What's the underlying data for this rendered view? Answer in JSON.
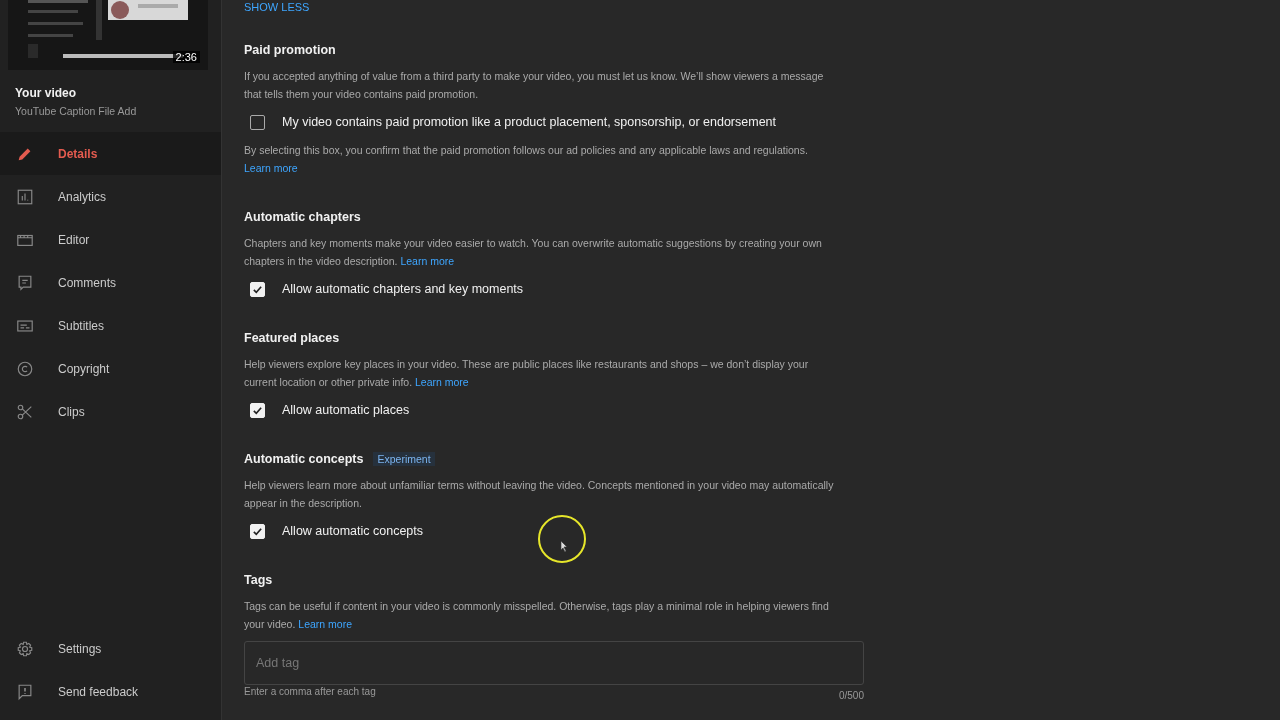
{
  "sidebar": {
    "video": {
      "kind": "picture",
      "duration": "2:36",
      "title": "Your video",
      "subtitle": "YouTube Caption File Add"
    },
    "items": [
      {
        "label": "Details",
        "selected": true
      },
      {
        "label": "Analytics",
        "selected": false
      },
      {
        "label": "Editor",
        "selected": false
      },
      {
        "label": "Comments",
        "selected": false
      },
      {
        "label": "Subtitles",
        "selected": false
      },
      {
        "label": "Copyright",
        "selected": false
      },
      {
        "label": "Clips",
        "selected": false
      }
    ],
    "footer": [
      {
        "label": "Settings"
      },
      {
        "label": "Send feedback"
      }
    ]
  },
  "show_less": "SHOW LESS",
  "sections": [
    {
      "heading": "Paid promotion",
      "description": "If you accepted anything of value from a third party to make your video, you must let us know. We’ll show viewers a message that tells them your video contains paid promotion.",
      "checkbox": {
        "label": "My video contains paid promotion like a product placement, sponsorship, or endorsement",
        "checked": false
      },
      "note": "By selecting this box, you confirm that the paid promotion follows our ad policies and any applicable laws and regulations.",
      "note_link": "Learn more"
    },
    {
      "heading": "Automatic chapters",
      "description": "Chapters and key moments make your video easier to watch. You can overwrite automatic suggestions by creating your own chapters in the video description.",
      "link": "Learn more",
      "checkbox": {
        "label": "Allow automatic chapters and key moments",
        "checked": true
      }
    },
    {
      "heading": "Featured places",
      "description": "Help viewers explore key places in your video. These are public places like restaurants and shops – we don’t display your current location or other private info.",
      "link": "Learn more",
      "checkbox": {
        "label": "Allow automatic places",
        "checked": true
      }
    },
    {
      "heading": "Automatic concepts",
      "badge": "Experiment",
      "description": "Help viewers learn more about unfamiliar terms without leaving the video. Concepts mentioned in your video may automatically appear in the description.",
      "checkbox": {
        "label": "Allow automatic concepts",
        "checked": true
      }
    },
    {
      "heading": "Tags",
      "description": "Tags can be useful if content in your video is commonly misspelled. Otherwise, tags play a minimal role in helping viewers find your video.",
      "link": "Learn more",
      "field": {
        "placeholder": "Add tag",
        "hint": "Enter a comma after each tag",
        "counter": "0/500"
      }
    }
  ]
}
